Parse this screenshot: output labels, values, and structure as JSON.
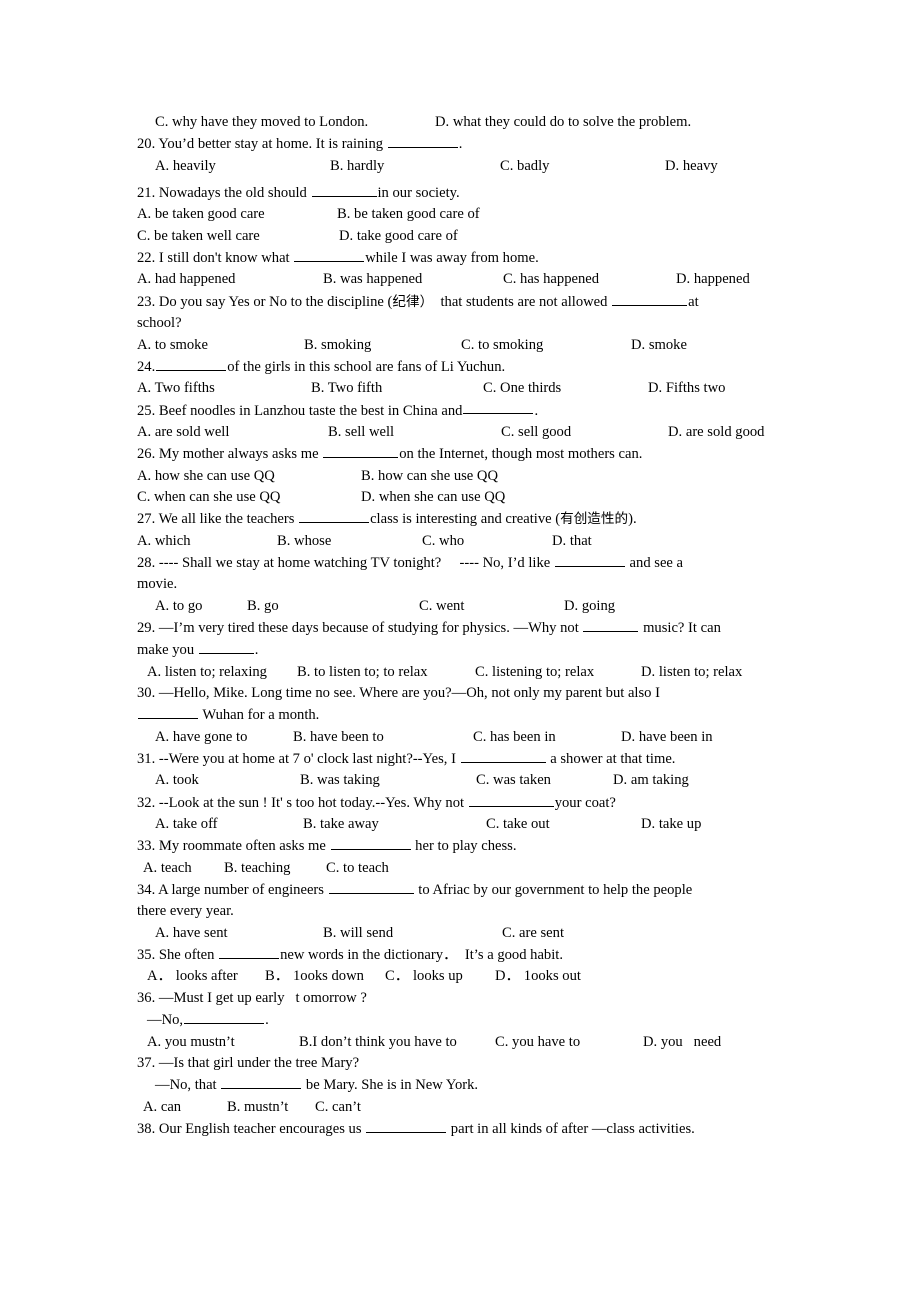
{
  "document": {
    "type": "english-grammar-worksheet",
    "page_background": "#ffffff",
    "text_color": "#000000",
    "questions": [
      {
        "id": "q19-tail",
        "carryover_options": [
          {
            "label": "C. why have they moved to London."
          },
          {
            "label": "D. what they could do to solve the problem."
          }
        ]
      },
      {
        "id": "q20",
        "stem_before": "20. You’d better stay at home. It is raining ",
        "stem_after": ".",
        "options": [
          {
            "label": "A. heavily"
          },
          {
            "label": "B. hardly"
          },
          {
            "label": "C. badly"
          },
          {
            "label": "D. heavy"
          }
        ]
      },
      {
        "id": "q21",
        "stem_before": "21. Nowadays the old should ",
        "stem_after": "in our society.",
        "options": [
          {
            "label": "A. be taken good care"
          },
          {
            "label": "B. be taken good care of"
          },
          {
            "label": "C. be taken well care"
          },
          {
            "label": "D. take good care of"
          }
        ]
      },
      {
        "id": "q22",
        "stem_before": "22. I still don't know what ",
        "stem_after": "while I was away from home.",
        "options": [
          {
            "label": "A. had happened"
          },
          {
            "label": "B. was happened"
          },
          {
            "label": "C. has happened"
          },
          {
            "label": "D. happened"
          }
        ]
      },
      {
        "id": "q23",
        "stem_line1_a": "23. Do you say Yes or No to the discipline (",
        "stem_cjk": "纪律）",
        "stem_line1_b": "  that students are not allowed ",
        "stem_line1_c": "at",
        "stem_line2": "school?",
        "options": [
          {
            "label": "A. to smoke"
          },
          {
            "label": "B. smoking"
          },
          {
            "label": "C. to smoking"
          },
          {
            "label": "D. smoke"
          }
        ]
      },
      {
        "id": "q24",
        "stem_before": "24.",
        "stem_after": "of the girls in this school are fans of Li Yuchun.",
        "options": [
          {
            "label": "A. Two fifths"
          },
          {
            "label": "B. Two fifth"
          },
          {
            "label": "C. One thirds"
          },
          {
            "label": "D. Fifths two"
          }
        ]
      },
      {
        "id": "q25",
        "stem_before": "25. Beef noodles in Lanzhou taste the best in China and",
        "stem_after": ".",
        "options": [
          {
            "label": "A. are sold well"
          },
          {
            "label": "B. sell well"
          },
          {
            "label": "C. sell good"
          },
          {
            "label": "D. are sold good"
          }
        ]
      },
      {
        "id": "q26",
        "stem_before": "26. My mother always asks me ",
        "stem_after": "on the Internet, though most mothers can.",
        "options": [
          {
            "label": "A. how she can use QQ"
          },
          {
            "label": "B. how can she use QQ"
          },
          {
            "label": "C. when can she use QQ"
          },
          {
            "label": "D. when she can use QQ"
          }
        ]
      },
      {
        "id": "q27",
        "stem_before": "27. We all like the teachers ",
        "stem_mid": "class is interesting and creative (",
        "stem_cjk": "有创造性的",
        "stem_after": ").",
        "options": [
          {
            "label": "A. which"
          },
          {
            "label": "B. whose"
          },
          {
            "label": "C. who"
          },
          {
            "label": "D. that"
          }
        ]
      },
      {
        "id": "q28",
        "stem_line1_a": "28. ---- Shall we stay at home watching TV tonight?     ---- No, I’d like ",
        "stem_line1_b": " and see a",
        "stem_line2": "movie.",
        "options": [
          {
            "label": "A. to go"
          },
          {
            "label": "B. go"
          },
          {
            "label": "C. went"
          },
          {
            "label": "D. going"
          }
        ]
      },
      {
        "id": "q29",
        "stem_line1_a": "29. —I’m very tired these days because of studying for physics. —Why not ",
        "stem_line1_b": " music? It can",
        "stem_line2_a": "make you ",
        "stem_line2_b": ".",
        "options": [
          {
            "label": "A. listen to; relaxing"
          },
          {
            "label": "B. to listen to; to relax"
          },
          {
            "label": "C. listening to; relax"
          },
          {
            "label": "D. listen to; relax"
          }
        ]
      },
      {
        "id": "q30",
        "stem_line1": "30. —Hello, Mike. Long time no see. Where are you?—Oh, not only my parent but also I",
        "stem_line2_after": " Wuhan for a month.",
        "options": [
          {
            "label": "A. have gone to"
          },
          {
            "label": "B. have been to"
          },
          {
            "label": "C. has been in"
          },
          {
            "label": "D. have been in"
          }
        ]
      },
      {
        "id": "q31",
        "stem_before": "31. --Were you at home at 7 o' clock last night?--Yes, I ",
        "stem_after": " a shower at that time.",
        "options": [
          {
            "label": "A. took"
          },
          {
            "label": "B. was taking"
          },
          {
            "label": "C. was taken"
          },
          {
            "label": "D. am taking"
          }
        ]
      },
      {
        "id": "q32",
        "stem_before": "32. --Look at the sun ! It' s too hot today.--Yes. Why not ",
        "stem_after": "your coat?",
        "options": [
          {
            "label": "A. take off"
          },
          {
            "label": "B. take away"
          },
          {
            "label": "C. take out"
          },
          {
            "label": "D. take up"
          }
        ]
      },
      {
        "id": "q33",
        "stem_before": "33. My roommate often asks me ",
        "stem_after": " her to play chess.",
        "options": [
          {
            "label": "A. teach"
          },
          {
            "label": "B. teaching"
          },
          {
            "label": "C. to teach"
          }
        ]
      },
      {
        "id": "q34",
        "stem_line1_a": "34. A large number of engineers ",
        "stem_line1_b": " to Afriac by our government to help the people",
        "stem_line2": "there every year.",
        "options": [
          {
            "label": "A. have sent"
          },
          {
            "label": "B. will send"
          },
          {
            "label": "C. are sent"
          }
        ]
      },
      {
        "id": "q35",
        "stem_before": "35. She often ",
        "stem_after": "new words in the dictionary．  It’s a good habit.",
        "options": [
          {
            "label": "A． looks after"
          },
          {
            "label": "B． 1ooks down"
          },
          {
            "label": "C． looks up"
          },
          {
            "label": "D． 1ooks out"
          }
        ]
      },
      {
        "id": "q36",
        "stem_line1": "36. —Must I get up early   t omorrow ?",
        "stem_line2_before": "—No,",
        "stem_line2_after": ".",
        "options": [
          {
            "label": "A. you mustn’t"
          },
          {
            "label": "B.I don’t think you have to"
          },
          {
            "label": "C. you have to"
          },
          {
            "label": "D. you   need"
          }
        ]
      },
      {
        "id": "q37",
        "stem_line1": "37. —Is that girl under the tree Mary?",
        "stem_line2_before": "—No, that ",
        "stem_line2_after": " be Mary. She is in New York.",
        "options": [
          {
            "label": "A. can"
          },
          {
            "label": "B. mustn’t"
          },
          {
            "label": "C. can’t"
          }
        ]
      },
      {
        "id": "q38",
        "stem_before": "38. Our English teacher encourages us ",
        "stem_after": " part in all kinds of after —class activities."
      }
    ]
  }
}
